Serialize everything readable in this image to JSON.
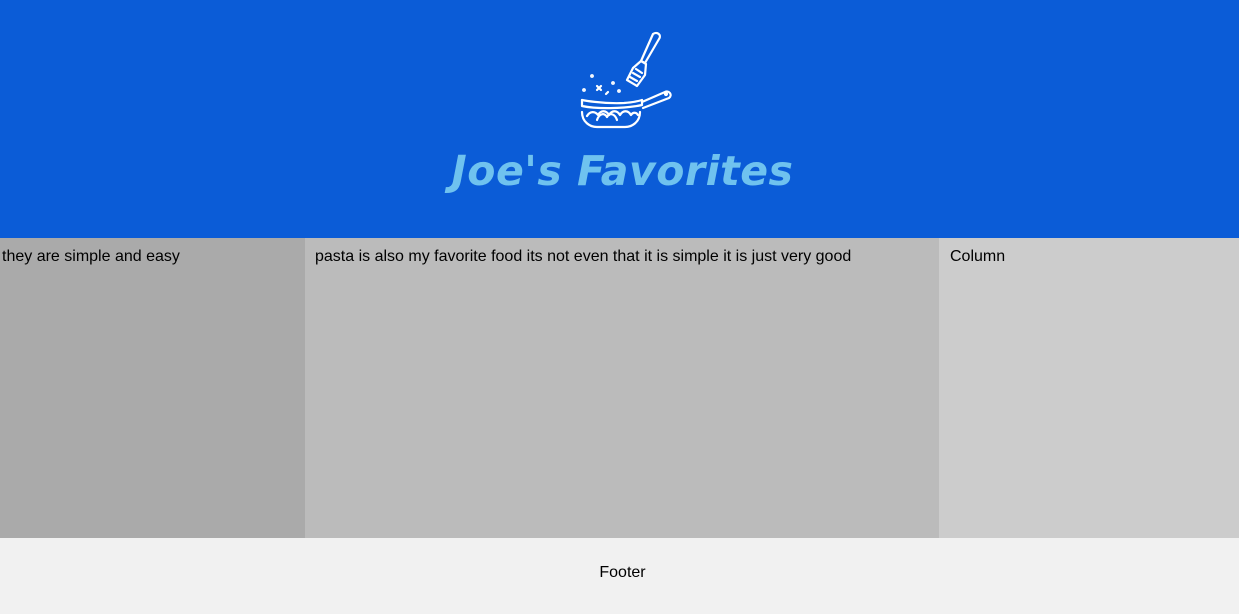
{
  "header": {
    "logo_icon": "frying-pan-spatula-icon",
    "title": "Joe's Favorites",
    "background_color": "#0b5cd7",
    "title_color": "#6fc2ef"
  },
  "columns": {
    "left": {
      "text": "they are simple and easy",
      "background_color": "#aaaaaa"
    },
    "middle": {
      "text": "pasta is also my favorite food its not even that it is simple it is just very good",
      "background_color": "#bbbbbb"
    },
    "right": {
      "text": "Column",
      "background_color": "#cccccc"
    }
  },
  "footer": {
    "text": "Footer",
    "background_color": "#f1f1f1"
  }
}
